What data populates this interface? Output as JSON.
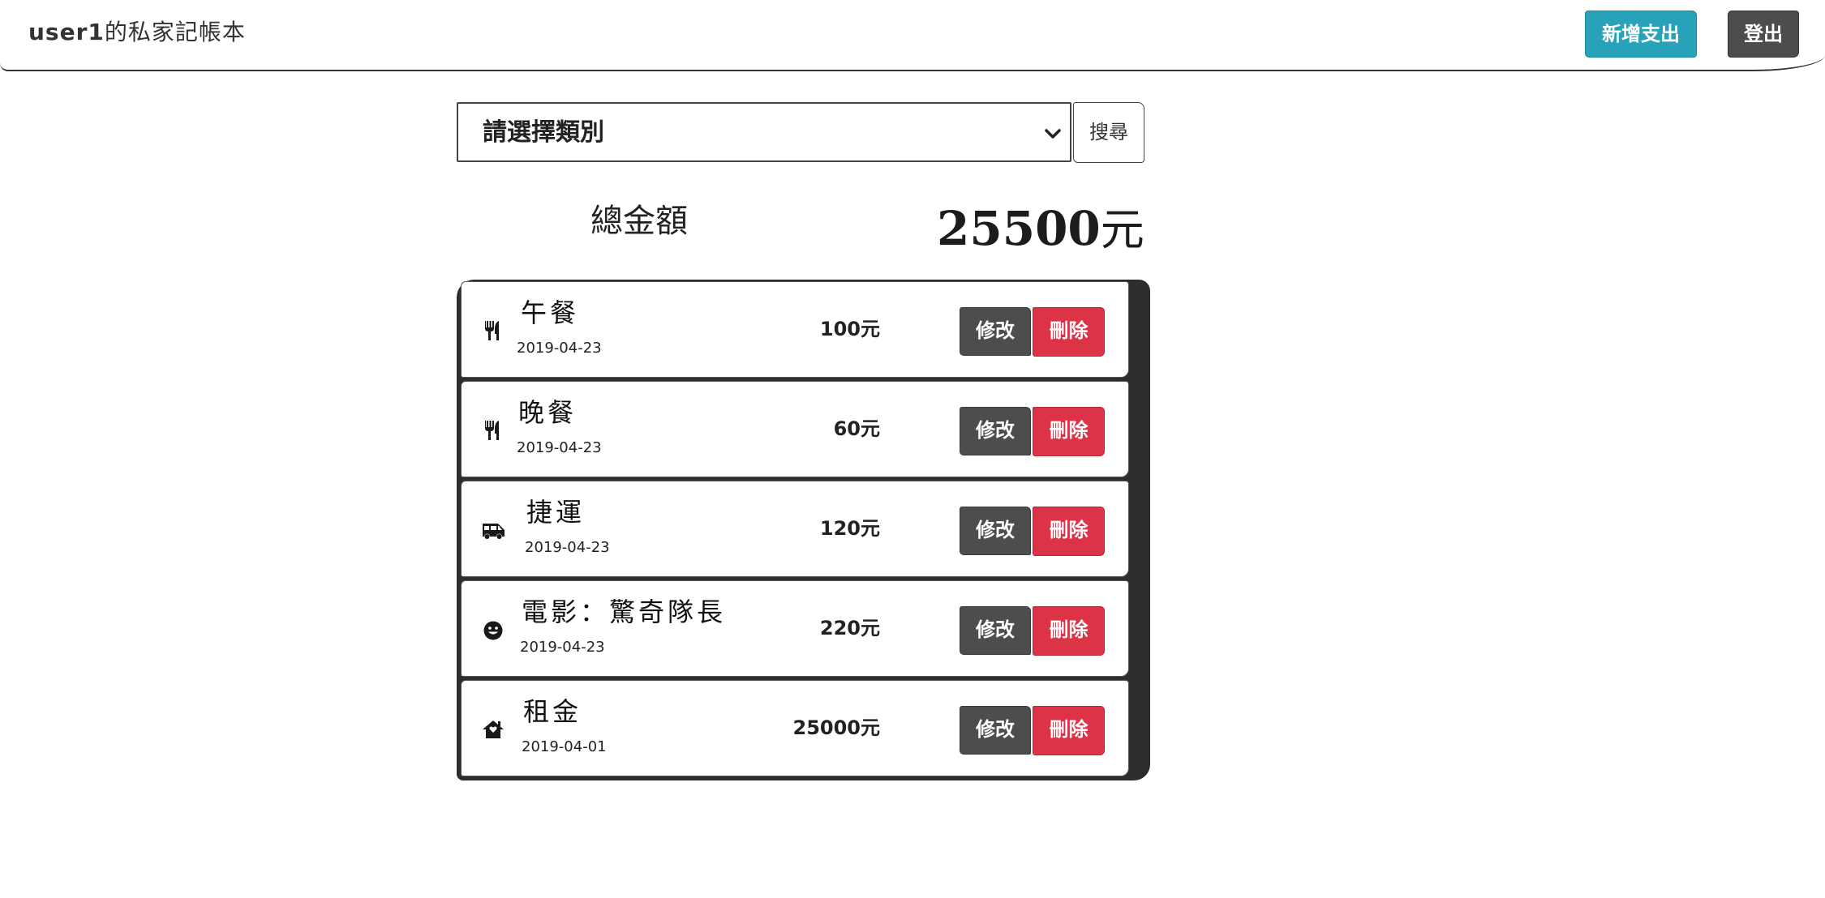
{
  "header": {
    "user": "user1",
    "title_suffix": "的私家記帳本",
    "add_button": "新增支出",
    "logout_button": "登出"
  },
  "filter": {
    "category_select": "請選擇類別",
    "search_button": "搜尋"
  },
  "summary": {
    "total_label": "總金額",
    "total_value": "25500",
    "total_unit": "元"
  },
  "expenses": [
    {
      "icon": "utensils-icon",
      "name": "午餐",
      "date": "2019-04-23",
      "amount": "100元",
      "edit": "修改",
      "delete": "刪除"
    },
    {
      "icon": "utensils-icon",
      "name": "晚餐",
      "date": "2019-04-23",
      "amount": "60元",
      "edit": "修改",
      "delete": "刪除"
    },
    {
      "icon": "shuttle-van-icon",
      "name": "捷運",
      "date": "2019-04-23",
      "amount": "120元",
      "edit": "修改",
      "delete": "刪除"
    },
    {
      "icon": "smile-icon",
      "name": "電影：驚奇隊長",
      "date": "2019-04-23",
      "amount": "220元",
      "edit": "修改",
      "delete": "刪除"
    },
    {
      "icon": "home-icon",
      "name": "租金",
      "date": "2019-04-01",
      "amount": "25000元",
      "edit": "修改",
      "delete": "刪除"
    }
  ],
  "colors": {
    "add_button": "#27a2b8",
    "edit_button": "#4d4d4d",
    "delete_button": "#dc3347",
    "logout_button": "#4d4d4d"
  }
}
